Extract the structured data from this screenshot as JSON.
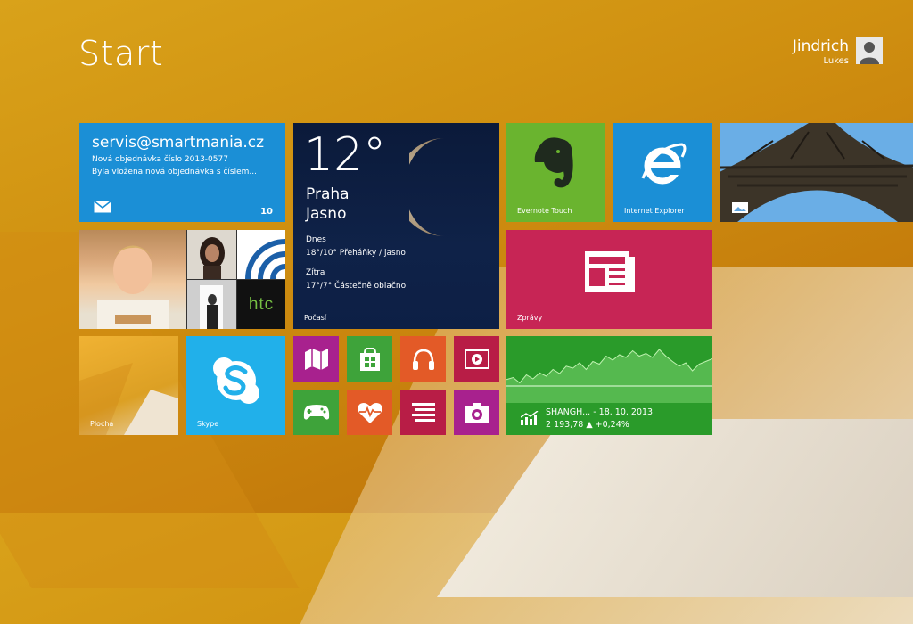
{
  "screen": {
    "title": "Start"
  },
  "user": {
    "first_name": "Jindrich",
    "last_name": "Lukes"
  },
  "tiles": {
    "mail": {
      "address": "servis@smartmania.cz",
      "line1": "Nová objednávka číslo 2013-0577",
      "line2": "Byla vložena nová objednávka s číslem...",
      "count": "10"
    },
    "weather": {
      "temp": "12°",
      "city": "Praha",
      "condition": "Jasno",
      "today_label": "Dnes",
      "today_value": "18°/10° Přeháňky / jasno",
      "tomorrow_label": "Zítra",
      "tomorrow_value": "17°/7° Částečně oblačno",
      "label": "Počasí"
    },
    "people": {
      "htc_text": "htc"
    },
    "evernote": {
      "label": "Evernote Touch"
    },
    "ie": {
      "label": "Internet Explorer"
    },
    "news": {
      "label": "Zprávy"
    },
    "desktop": {
      "label": "Plocha"
    },
    "skype": {
      "label": "Skype"
    },
    "finance": {
      "line1": "SHANGH... - 18. 10. 2013",
      "line2": "2 193,78 ▲ +0,24%",
      "chart_values": [
        0.35,
        0.38,
        0.3,
        0.42,
        0.36,
        0.45,
        0.4,
        0.5,
        0.44,
        0.55,
        0.52,
        0.6,
        0.5,
        0.62,
        0.58,
        0.7,
        0.64,
        0.72,
        0.68,
        0.78,
        0.7,
        0.74,
        0.68,
        0.8,
        0.7,
        0.62,
        0.55,
        0.6,
        0.48,
        0.58,
        0.62,
        0.66
      ]
    }
  },
  "colors": {
    "background": "#cf8f10",
    "mail": "#1b8fd6",
    "weather": "#0f2248",
    "green": "#3ea33a",
    "magenta": "#a8218e",
    "orange": "#e35a27",
    "crimson": "#b81d46",
    "news": "#c72555",
    "skype": "#21b0ea",
    "evernote": "#6ab42f",
    "finance": "#2a9b2a"
  },
  "icons": [
    "mail-icon",
    "moon-icon",
    "evernote-elephant-icon",
    "ie-icon",
    "photos-icon",
    "news-icon",
    "skype-icon",
    "travel-map-icon",
    "store-icon",
    "headphones-icon",
    "video-icon",
    "gamepad-icon",
    "heart-pulse-icon",
    "reading-list-icon",
    "camera-icon",
    "finance-chart-icon",
    "user-avatar-icon"
  ]
}
